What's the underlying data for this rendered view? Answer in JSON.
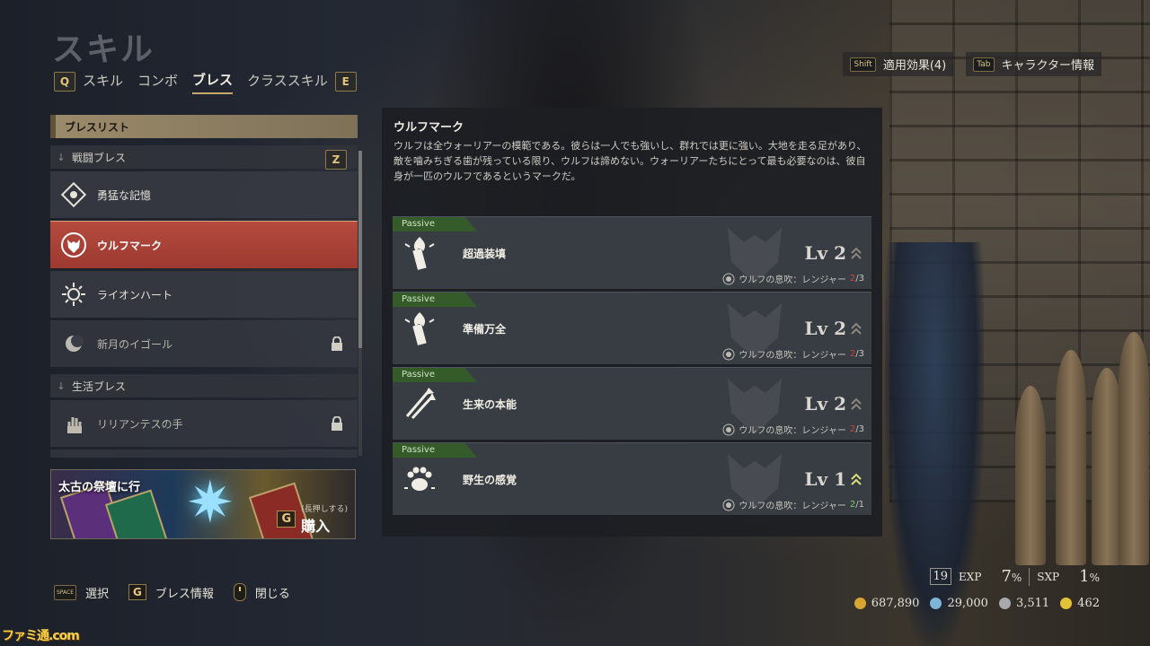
{
  "page_title": "スキル",
  "tabs": {
    "left_key": "Q",
    "right_key": "E",
    "items": [
      {
        "label": "スキル"
      },
      {
        "label": "コンボ"
      },
      {
        "label": "ブレス",
        "active": true
      },
      {
        "label": "クラススキル"
      }
    ]
  },
  "top_right": {
    "effects": {
      "key": "Shift",
      "label": "適用効果(4)"
    },
    "character": {
      "key": "Tab",
      "label": "キャラクター情報"
    }
  },
  "bless_list": {
    "header": "ブレスリスト",
    "combat": {
      "label": "戦闘ブレス",
      "key": "Z",
      "items": [
        {
          "label": "勇猛な記憶",
          "locked": false
        },
        {
          "label": "ウルフマーク",
          "locked": false,
          "selected": true
        },
        {
          "label": "ライオンハート",
          "locked": false
        },
        {
          "label": "新月のイゴール",
          "locked": true
        }
      ]
    },
    "life": {
      "label": "生活ブレス",
      "items": [
        {
          "label": "リリアンテスの手",
          "locked": true
        }
      ]
    }
  },
  "promo": {
    "text": "太古の祭壇に行",
    "buy_key": "G",
    "buy_hold": "(長押しする)",
    "buy_label": "購入"
  },
  "detail": {
    "title": "ウルフマーク",
    "description": "ウルフは全ウォーリアーの模範である。彼らは一人でも強いし、群れでは更に強い。大地を走る足があり、敵を噛みちぎる歯が残っている限り、ウルフは諦めない。ウォーリアーたちにとって最も必要なのは、彼自身が一匹のウルフであるというマークだ。",
    "passives": [
      {
        "tag": "Passive",
        "name": "超過装填",
        "level": "Lv 2",
        "requirement": "ウルフの息吹：レンジャー",
        "count": "2",
        "total": "/3",
        "met": false,
        "icon": "torch-icon"
      },
      {
        "tag": "Passive",
        "name": "準備万全",
        "level": "Lv 2",
        "requirement": "ウルフの息吹：レンジャー",
        "count": "2",
        "total": "/3",
        "met": false,
        "icon": "torch-icon"
      },
      {
        "tag": "Passive",
        "name": "生来の本能",
        "level": "Lv 2",
        "requirement": "ウルフの息吹：レンジャー",
        "count": "2",
        "total": "/3",
        "met": false,
        "icon": "arrows-icon"
      },
      {
        "tag": "Passive",
        "name": "野生の感覚",
        "level": "Lv 1",
        "requirement": "ウルフの息吹：レンジャー",
        "count": "2",
        "total": "/1",
        "met": true,
        "icon": "paw-icon"
      }
    ]
  },
  "footer": {
    "select_key": "SPACE",
    "select_label": "選択",
    "info_key": "G",
    "info_label": "ブレス情報",
    "close_label": "閉じる"
  },
  "stats": {
    "level": "19",
    "exp_label": "EXP",
    "exp_value": "7",
    "exp_unit": "%",
    "sxp_label": "SXP",
    "sxp_value": "1",
    "sxp_unit": "%",
    "gold": "687,890",
    "currency2": "29,000",
    "currency3": "3,511",
    "currency4": "462"
  },
  "site_logo": "ファミ通.com",
  "colors": {
    "accent_gold": "#c8a86a",
    "selected_red": "#b54a3e",
    "passive_green": "#355b2b",
    "count_red": "#c8453a",
    "count_green": "#7fcf5c"
  }
}
